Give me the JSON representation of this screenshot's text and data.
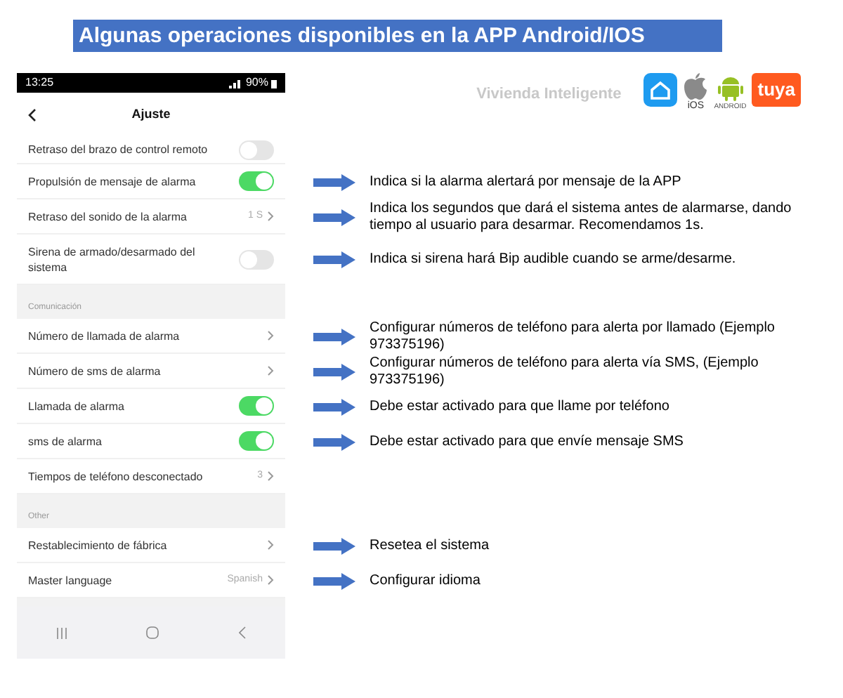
{
  "title": "Algunas operaciones disponibles en la APP Android/IOS",
  "branding": {
    "tagline": "Vivienda Inteligente",
    "logos": [
      {
        "kind": "smart_home"
      },
      {
        "kind": "apple",
        "label": "iOS"
      },
      {
        "kind": "android",
        "label": "ANDROID"
      },
      {
        "kind": "tuya",
        "label": "tuya"
      }
    ]
  },
  "phone": {
    "status_bar": {
      "time": "13:25",
      "battery": "90%"
    },
    "header": {
      "title": "Ajuste"
    },
    "rows": [
      {
        "kind": "toggle",
        "label": "Retraso del brazo de control remoto",
        "on": false
      },
      {
        "kind": "toggle",
        "label": "Propulsión de mensaje de alarma",
        "on": true,
        "note": "Indica si la alarma alertará por mensaje de la APP"
      },
      {
        "kind": "value",
        "label": "Retraso del sonido de la alarma",
        "value": "1 S",
        "note": "Indica los segundos que dará el sistema antes de alarmarse, dando tiempo al usuario para desarmar.  Recomendamos 1s."
      },
      {
        "kind": "toggle",
        "label": "Sirena de armado/desarmado del sistema",
        "on": false,
        "note": "Indica si sirena hará Bip audible cuando se arme/desarme."
      },
      {
        "kind": "section",
        "label": "Comunicación"
      },
      {
        "kind": "link",
        "label": "Número de llamada de alarma",
        "note": "Configurar números de teléfono para alerta por llamado (Ejemplo 973375196)"
      },
      {
        "kind": "link",
        "label": "Número de sms de alarma",
        "note": "Configurar números de teléfono para alerta vía SMS, (Ejemplo 973375196)"
      },
      {
        "kind": "toggle",
        "label": "Llamada de alarma",
        "on": true,
        "note": "Debe estar activado para que llame por teléfono"
      },
      {
        "kind": "toggle",
        "label": "sms de alarma",
        "on": true,
        "note": "Debe estar activado para que envíe mensaje SMS"
      },
      {
        "kind": "value",
        "label": "Tiempos de teléfono desconectado",
        "value": "3"
      },
      {
        "kind": "section",
        "label": "Other"
      },
      {
        "kind": "link",
        "label": "Restablecimiento de fábrica",
        "note": "Resetea el sistema"
      },
      {
        "kind": "value",
        "label": "Master language",
        "value": "Spanish",
        "note": "Configurar idioma"
      }
    ]
  }
}
